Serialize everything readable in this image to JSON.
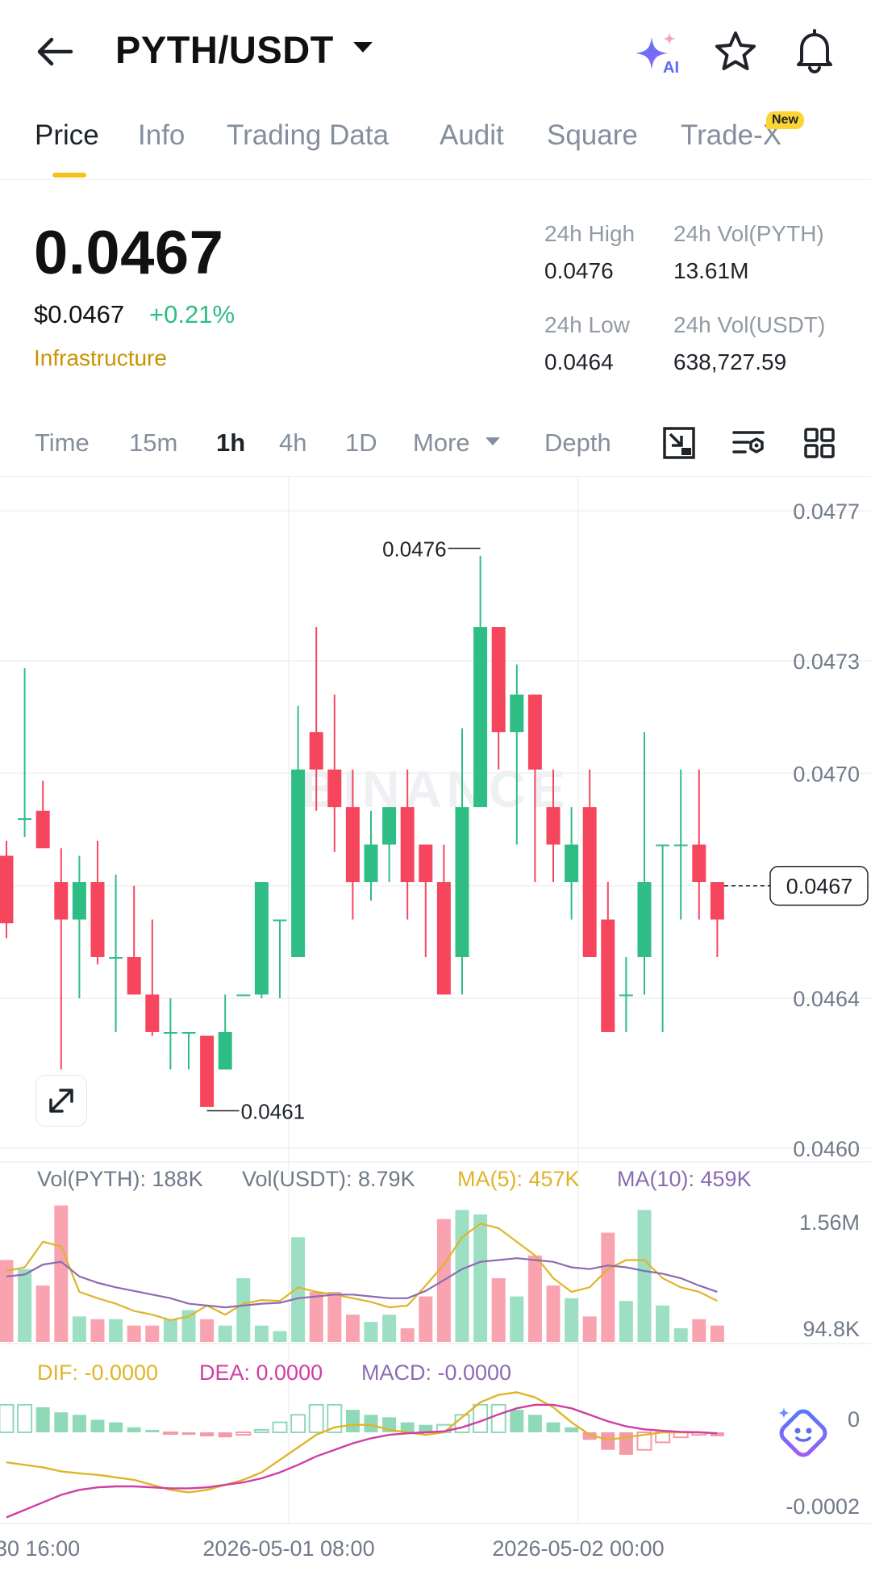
{
  "header": {
    "pair": "PYTH/USDT",
    "ai_badge": "AI",
    "icons": [
      "back-arrow-icon",
      "dropdown-caret-icon",
      "ai-sparkle-icon",
      "star-icon",
      "bell-icon"
    ]
  },
  "tabs": [
    {
      "label": "Price",
      "active": true
    },
    {
      "label": "Info",
      "active": false
    },
    {
      "label": "Trading Data",
      "active": false
    },
    {
      "label": "Audit",
      "active": false
    },
    {
      "label": "Square",
      "active": false
    },
    {
      "label": "Trade-X",
      "active": false,
      "badge": "New"
    }
  ],
  "price": {
    "last": "0.0467",
    "usd": "$0.0467",
    "change_pct": "+0.21%",
    "category": "Infrastructure"
  },
  "stats": {
    "high_label": "24h High",
    "high_value": "0.0476",
    "low_label": "24h Low",
    "low_value": "0.0464",
    "vol_base_label": "24h Vol(PYTH)",
    "vol_base_value": "13.61M",
    "vol_quote_label": "24h Vol(USDT)",
    "vol_quote_value": "638,727.59"
  },
  "intervals": {
    "items": [
      "Time",
      "15m",
      "1h",
      "4h",
      "1D"
    ],
    "active": "1h",
    "more": "More",
    "depth": "Depth",
    "icons": [
      "chart-resize-icon",
      "indicator-settings-icon",
      "grid-layout-icon"
    ]
  },
  "colors": {
    "up": "#2ebd85",
    "down": "#f6465d",
    "accent": "#fcd535",
    "ma5": "#e0b429",
    "ma10": "#8c6bb1",
    "dif": "#e0b429",
    "dea": "#cf3ea3"
  },
  "chart_data": {
    "type": "candlestick",
    "price_axis_ticks": [
      "0.0477",
      "0.0473",
      "0.0470",
      "0.0467",
      "0.0464",
      "0.0460"
    ],
    "ylim": [
      0.046,
      0.0477
    ],
    "current_price": "0.0467",
    "max_marker": {
      "label": "0.0476",
      "value": 0.0476
    },
    "min_marker": {
      "label": "0.0461",
      "value": 0.0461
    },
    "x_labels": [
      "30 16:00",
      "2026-05-01 08:00",
      "2026-05-02 00:00"
    ],
    "candles": [
      {
        "o": 0.04678,
        "h": 0.04682,
        "l": 0.04656,
        "c": 0.0466
      },
      {
        "o": 0.04688,
        "h": 0.04728,
        "l": 0.04683,
        "c": 0.04688
      },
      {
        "o": 0.0469,
        "h": 0.04698,
        "l": 0.0468,
        "c": 0.0468
      },
      {
        "o": 0.04671,
        "h": 0.0468,
        "l": 0.04621,
        "c": 0.04661
      },
      {
        "o": 0.04661,
        "h": 0.04678,
        "l": 0.0464,
        "c": 0.04671
      },
      {
        "o": 0.04671,
        "h": 0.04682,
        "l": 0.04649,
        "c": 0.04651
      },
      {
        "o": 0.04651,
        "h": 0.04673,
        "l": 0.04631,
        "c": 0.04651
      },
      {
        "o": 0.04651,
        "h": 0.0467,
        "l": 0.04641,
        "c": 0.04641
      },
      {
        "o": 0.04641,
        "h": 0.04661,
        "l": 0.0463,
        "c": 0.04631
      },
      {
        "o": 0.04631,
        "h": 0.0464,
        "l": 0.04621,
        "c": 0.04631
      },
      {
        "o": 0.04631,
        "h": 0.04631,
        "l": 0.04621,
        "c": 0.04631
      },
      {
        "o": 0.0463,
        "h": 0.0463,
        "l": 0.04612,
        "c": 0.04611
      },
      {
        "o": 0.04621,
        "h": 0.04641,
        "l": 0.04621,
        "c": 0.04631
      },
      {
        "o": 0.04641,
        "h": 0.04641,
        "l": 0.04641,
        "c": 0.04641
      },
      {
        "o": 0.04641,
        "h": 0.04671,
        "l": 0.0464,
        "c": 0.04671
      },
      {
        "o": 0.04661,
        "h": 0.04661,
        "l": 0.0464,
        "c": 0.04661
      },
      {
        "o": 0.04651,
        "h": 0.04718,
        "l": 0.04651,
        "c": 0.04701
      },
      {
        "o": 0.04711,
        "h": 0.04739,
        "l": 0.0469,
        "c": 0.04701
      },
      {
        "o": 0.04701,
        "h": 0.04721,
        "l": 0.04679,
        "c": 0.04691
      },
      {
        "o": 0.04691,
        "h": 0.04701,
        "l": 0.04661,
        "c": 0.04671
      },
      {
        "o": 0.04671,
        "h": 0.0469,
        "l": 0.04666,
        "c": 0.04681
      },
      {
        "o": 0.04681,
        "h": 0.04691,
        "l": 0.04671,
        "c": 0.04691
      },
      {
        "o": 0.04691,
        "h": 0.04701,
        "l": 0.04661,
        "c": 0.04671
      },
      {
        "o": 0.04681,
        "h": 0.04681,
        "l": 0.04651,
        "c": 0.04671
      },
      {
        "o": 0.04671,
        "h": 0.04681,
        "l": 0.04641,
        "c": 0.04641
      },
      {
        "o": 0.04651,
        "h": 0.04712,
        "l": 0.04641,
        "c": 0.04691
      },
      {
        "o": 0.04691,
        "h": 0.04758,
        "l": 0.04691,
        "c": 0.04739
      },
      {
        "o": 0.04739,
        "h": 0.04739,
        "l": 0.04701,
        "c": 0.04711
      },
      {
        "o": 0.04711,
        "h": 0.04729,
        "l": 0.04681,
        "c": 0.04721
      },
      {
        "o": 0.04721,
        "h": 0.04721,
        "l": 0.04671,
        "c": 0.04701
      },
      {
        "o": 0.04691,
        "h": 0.04701,
        "l": 0.04671,
        "c": 0.04681
      },
      {
        "o": 0.04671,
        "h": 0.04691,
        "l": 0.04661,
        "c": 0.04681
      },
      {
        "o": 0.04691,
        "h": 0.04701,
        "l": 0.04651,
        "c": 0.04651
      },
      {
        "o": 0.04661,
        "h": 0.04671,
        "l": 0.04631,
        "c": 0.04631
      },
      {
        "o": 0.04641,
        "h": 0.04651,
        "l": 0.04631,
        "c": 0.04641
      },
      {
        "o": 0.04651,
        "h": 0.04711,
        "l": 0.04641,
        "c": 0.04671
      },
      {
        "o": 0.04681,
        "h": 0.04681,
        "l": 0.04631,
        "c": 0.04681
      },
      {
        "o": 0.04681,
        "h": 0.04701,
        "l": 0.04661,
        "c": 0.04681
      },
      {
        "o": 0.04681,
        "h": 0.04701,
        "l": 0.04661,
        "c": 0.04671
      },
      {
        "o": 0.04671,
        "h": 0.04671,
        "l": 0.04651,
        "c": 0.04661
      }
    ],
    "volume": {
      "label_base": "Vol(PYTH): 188K",
      "label_quote": "Vol(USDT): 8.79K",
      "label_ma5": "MA(5): 457K",
      "label_ma10": "MA(10): 459K",
      "axis_top": "1.56M",
      "axis_bottom": "94.8K",
      "max": 1.56,
      "bars": [
        0.9,
        0.8,
        0.62,
        1.5,
        0.28,
        0.25,
        0.25,
        0.18,
        0.18,
        0.25,
        0.35,
        0.25,
        0.18,
        0.7,
        0.18,
        0.12,
        1.15,
        0.55,
        0.55,
        0.3,
        0.22,
        0.3,
        0.15,
        0.5,
        1.35,
        1.45,
        1.4,
        0.7,
        0.5,
        0.95,
        0.62,
        0.48,
        0.28,
        1.2,
        0.45,
        1.45,
        0.4,
        0.15,
        0.25,
        0.18
      ],
      "ma5": [
        0.78,
        0.82,
        1.1,
        1.05,
        0.55,
        0.48,
        0.42,
        0.34,
        0.3,
        0.24,
        0.28,
        0.4,
        0.3,
        0.42,
        0.46,
        0.45,
        0.6,
        0.55,
        0.52,
        0.48,
        0.44,
        0.38,
        0.4,
        0.62,
        0.85,
        1.15,
        1.3,
        1.25,
        1.1,
        0.95,
        0.7,
        0.55,
        0.6,
        0.8,
        0.9,
        0.9,
        0.7,
        0.6,
        0.55,
        0.45
      ],
      "ma10": [
        0.72,
        0.74,
        0.85,
        0.88,
        0.72,
        0.65,
        0.6,
        0.56,
        0.52,
        0.48,
        0.42,
        0.4,
        0.38,
        0.4,
        0.42,
        0.43,
        0.48,
        0.5,
        0.52,
        0.52,
        0.5,
        0.48,
        0.48,
        0.56,
        0.68,
        0.8,
        0.88,
        0.9,
        0.92,
        0.9,
        0.88,
        0.82,
        0.8,
        0.84,
        0.82,
        0.78,
        0.75,
        0.7,
        0.62,
        0.55
      ]
    },
    "macd": {
      "label_dif": "DIF: -0.0000",
      "label_dea": "DEA: 0.0000",
      "label_macd": "MACD: -0.0000",
      "axis_top": "0",
      "axis_bottom": "-0.0002",
      "hist": [
        0.55,
        0.55,
        0.5,
        0.4,
        0.35,
        0.25,
        0.2,
        0.1,
        0.05,
        -0.03,
        -0.05,
        -0.08,
        -0.1,
        -0.05,
        0.05,
        0.2,
        0.35,
        0.55,
        0.55,
        0.45,
        0.35,
        0.3,
        0.2,
        0.15,
        0.15,
        0.35,
        0.55,
        0.55,
        0.45,
        0.35,
        0.2,
        0.1,
        -0.15,
        -0.35,
        -0.45,
        -0.35,
        -0.2,
        -0.1,
        -0.05,
        -0.08
      ],
      "dif": [
        -0.6,
        -0.65,
        -0.7,
        -0.78,
        -0.82,
        -0.85,
        -0.9,
        -0.95,
        -1.05,
        -1.15,
        -1.2,
        -1.15,
        -1.05,
        -0.95,
        -0.8,
        -0.55,
        -0.3,
        -0.05,
        0.1,
        0.15,
        0.15,
        0.05,
        0.0,
        -0.05,
        0.0,
        0.3,
        0.6,
        0.75,
        0.8,
        0.7,
        0.5,
        0.2,
        -0.05,
        -0.15,
        -0.1,
        -0.05,
        0.0,
        0.0,
        0.0,
        -0.02
      ],
      "dea": [
        -1.7,
        -1.55,
        -1.4,
        -1.25,
        -1.15,
        -1.1,
        -1.08,
        -1.08,
        -1.1,
        -1.12,
        -1.12,
        -1.1,
        -1.05,
        -1.0,
        -0.92,
        -0.8,
        -0.65,
        -0.48,
        -0.35,
        -0.22,
        -0.12,
        -0.05,
        -0.02,
        0.0,
        0.02,
        0.1,
        0.22,
        0.36,
        0.48,
        0.55,
        0.55,
        0.48,
        0.35,
        0.22,
        0.12,
        0.06,
        0.03,
        0.01,
        0.0,
        -0.02
      ]
    }
  }
}
